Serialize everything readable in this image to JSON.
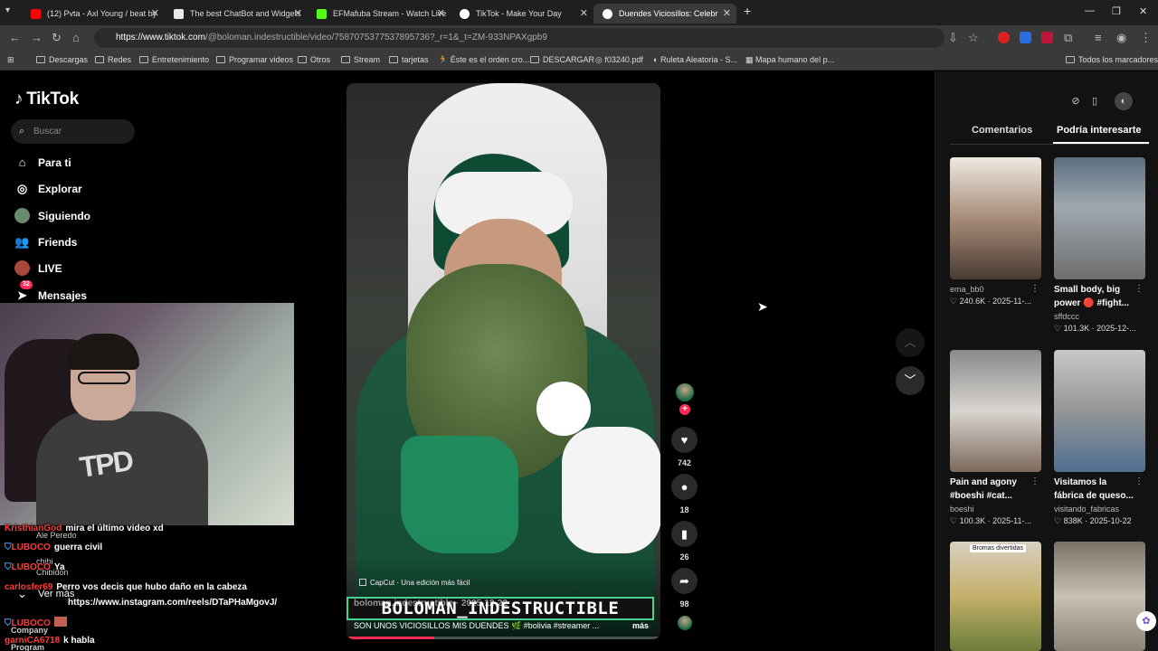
{
  "browser": {
    "tabs": [
      {
        "title": "(12) Pvta - Axl Young / beat by",
        "favicon_color": "#ff0000"
      },
      {
        "title": "The best ChatBot and Widgets",
        "favicon_color": "#e8e8e8"
      },
      {
        "title": "EFMafuba Stream - Watch Live",
        "favicon_color": "#53fc18"
      },
      {
        "title": "TikTok - Make Your Day",
        "favicon_color": "#ffffff"
      },
      {
        "title": "Duendes Viciosillos: Celebr",
        "favicon_color": "#ffffff"
      }
    ],
    "url_host": "https://www.tiktok.com",
    "url_path": "/@boloman.indestructible/video/7587075377537895736?_r=1&_t=ZM-933NPAXgpb9",
    "bookmarks": [
      "Descargas",
      "Redes",
      "Entretenimiento",
      "Programar videos",
      "Otros",
      "Stream",
      "tarjetas",
      "Éste es el orden cro...",
      "DESCARGAR",
      "f03240.pdf",
      "Ruleta Aleatoria - S...",
      "Mapa humano del p..."
    ],
    "all_bookmarks": "Todos los marcadores"
  },
  "tiktok": {
    "logo": "TikTok",
    "search_placeholder": "Buscar",
    "nav": {
      "for_you": "Para ti",
      "explore": "Explorar",
      "following": "Siguiendo",
      "friends": "Friends",
      "live": "LIVE",
      "messages": "Mensajes",
      "messages_badge": "32",
      "see_more": "Ver más",
      "company": "Company",
      "program": "Program"
    },
    "video": {
      "capcut": "CapCut · Una edición más fácil",
      "banner": "BOLOMAN_INDESTRUCTIBLE",
      "author": "boloman.indestructible · 2025-12-22",
      "description": "SON UNOS VICIOSILLOS MIS DUENDES 🌿 #bolivia #streamer ...",
      "more": "más",
      "progress": 0.28
    },
    "actions": {
      "likes": "742",
      "comments": "18",
      "saves": "26",
      "shares": "98"
    },
    "panel": {
      "tab_comments": "Comentarios",
      "tab_recommended": "Podría interesarte",
      "cards": [
        {
          "title": "",
          "author": "ema_bb0",
          "likes": "240.6K",
          "date": "2025-11-..."
        },
        {
          "title": "Small body, big power 🔴 #fight...",
          "author": "sffdccc",
          "likes": "101.3K",
          "date": "2025-12-..."
        },
        {
          "title": "Pain and agony #boeshi #cat...",
          "author": "boeshi",
          "likes": "100.3K",
          "date": "2025-11-..."
        },
        {
          "title": "Visitamos la fábrica de queso...",
          "author": "visitando_fabricas",
          "likes": "838K",
          "date": "2025-10-22"
        },
        {
          "title": "",
          "author": "",
          "likes": "",
          "date": "",
          "label": "Bromas divertidas"
        },
        {
          "title": "",
          "author": "",
          "likes": "",
          "date": ""
        }
      ]
    }
  },
  "chat": [
    {
      "user": "KristhianGod",
      "msg": "mira el último video xd",
      "color": "#ff3b3b"
    },
    {
      "user": "LUBOCO",
      "msg": "guerra civil",
      "color": "#ff3b3b"
    },
    {
      "user": "LUBOCO",
      "msg": "Ya",
      "color": "#ff3b3b"
    },
    {
      "user": "carlosfer69",
      "msg": "Perro vos decis que hubo daño en la cabeza",
      "color": "#ff3b3b"
    },
    {
      "user": "",
      "msg": "https://www.instagram.com/reels/DTaPHaMgovJ/",
      "color": "#ff3b3b"
    },
    {
      "user": "LUBOCO",
      "msg": "",
      "color": "#ff3b3b"
    },
    {
      "user": "garniCA6718",
      "msg": "k habla",
      "color": "#ff3b3b"
    }
  ],
  "chat_ghost": {
    "a": "Ale Peredo",
    "b": "chibi",
    "c": "Chibidon"
  }
}
